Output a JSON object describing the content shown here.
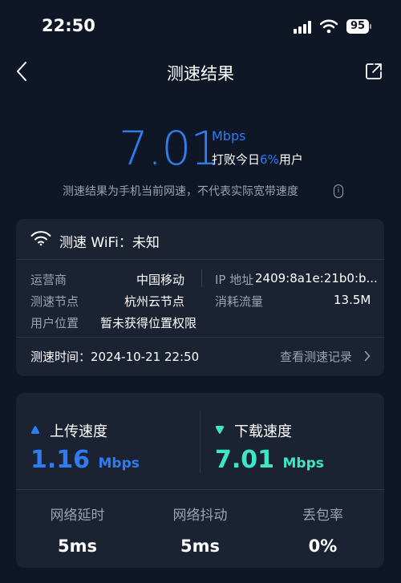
{
  "status": {
    "time": "22:50",
    "battery": "95"
  },
  "nav": {
    "title": "测速结果"
  },
  "hero": {
    "value": "7.01",
    "unit": "Mbps",
    "beat_prefix": "打败今日",
    "beat_pct": "6%",
    "beat_suffix": "用户",
    "note": "测速结果为手机当前网速，不代表实际宽带速度",
    "info": "i"
  },
  "network": {
    "wifi_label": "测速 WiFi：未知",
    "operator_key": "运营商",
    "operator_val": "中国移动",
    "node_key": "测速节点",
    "node_val": "杭州云节点",
    "location_key": "用户位置",
    "location_val": "暂未获得位置权限",
    "ip_key": "IP 地址",
    "ip_val": "2409:8a1e:21b0:b...",
    "traffic_key": "消耗流量",
    "traffic_val": "13.5M",
    "test_time": "测速时间：2024-10-21 22:50",
    "history": "查看测速记录"
  },
  "speeds": {
    "upload_label": "上传速度",
    "upload_value": "1.16",
    "upload_unit": "Mbps",
    "download_label": "下载速度",
    "download_value": "7.01",
    "download_unit": "Mbps"
  },
  "metrics": [
    {
      "label": "网络延时",
      "value": "5ms"
    },
    {
      "label": "网络抖动",
      "value": "5ms"
    },
    {
      "label": "丢包率",
      "value": "0%"
    }
  ],
  "colors": {
    "accent": "#2f7bf0",
    "download": "#3ee6c8",
    "bg": "#0f1626",
    "card": "#1b2333"
  }
}
